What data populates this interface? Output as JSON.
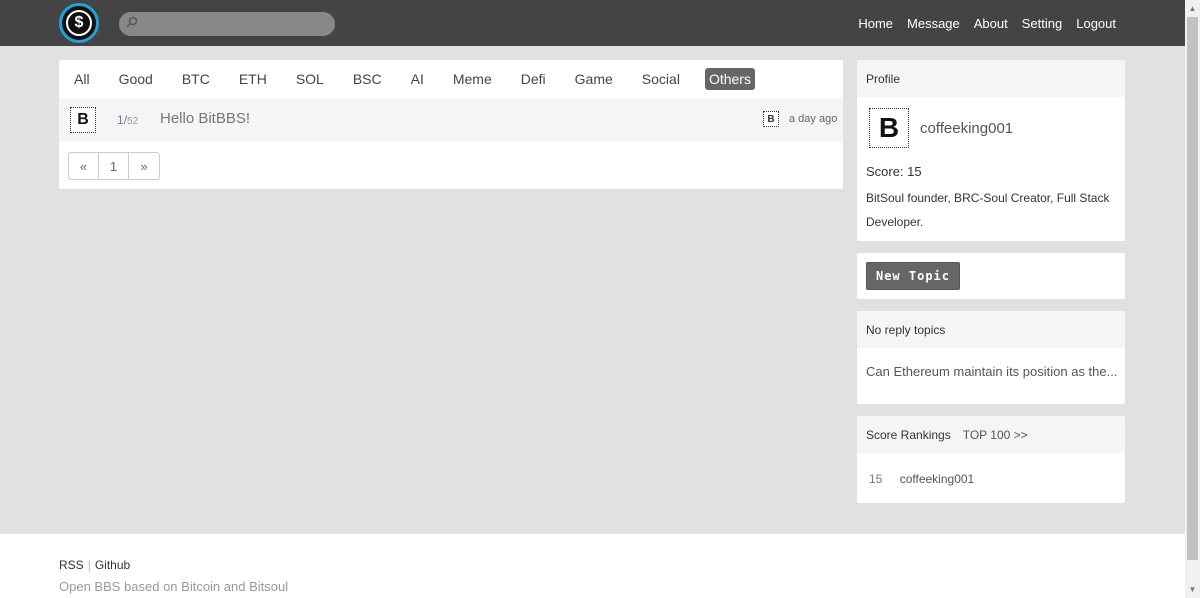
{
  "header": {
    "logo_glyph": "$",
    "search_placeholder": "",
    "nav": [
      "Home",
      "Message",
      "About",
      "Setting",
      "Logout"
    ]
  },
  "tabs": [
    {
      "label": "All",
      "active": false
    },
    {
      "label": "Good",
      "active": false
    },
    {
      "label": "BTC",
      "active": false
    },
    {
      "label": "ETH",
      "active": false
    },
    {
      "label": "SOL",
      "active": false
    },
    {
      "label": "BSC",
      "active": false
    },
    {
      "label": "AI",
      "active": false
    },
    {
      "label": "Meme",
      "active": false
    },
    {
      "label": "Defi",
      "active": false
    },
    {
      "label": "Game",
      "active": false
    },
    {
      "label": "Social",
      "active": false
    },
    {
      "label": "Others",
      "active": true
    }
  ],
  "topic": {
    "replies": "1",
    "sep": "/",
    "views": "52",
    "title": "Hello BitBBS!",
    "time": "a day ago",
    "avatar_glyph": "B"
  },
  "pager": {
    "prev": "«",
    "page": "1",
    "next": "»"
  },
  "profile": {
    "heading": "Profile",
    "name": "coffeeking001",
    "avatar_glyph": "B",
    "score": "Score: 15",
    "bio": "BitSoul founder, BRC-Soul Creator, Full Stack Developer."
  },
  "new_topic_label": "New Topic",
  "no_reply": {
    "heading": "No reply topics",
    "item": "Can Ethereum maintain its position as the..."
  },
  "rankings": {
    "heading": "Score Rankings",
    "top_link": "TOP 100 >>",
    "rows": [
      {
        "score": "15",
        "name": "coffeeking001"
      }
    ]
  },
  "footer": {
    "rss": "RSS",
    "github": "Github",
    "tagline": "Open BBS based on Bitcoin and Bitsoul"
  },
  "colors": {
    "topbar": "#444444",
    "active_tab": "#666666",
    "accent_count": "#7a6fb5"
  }
}
